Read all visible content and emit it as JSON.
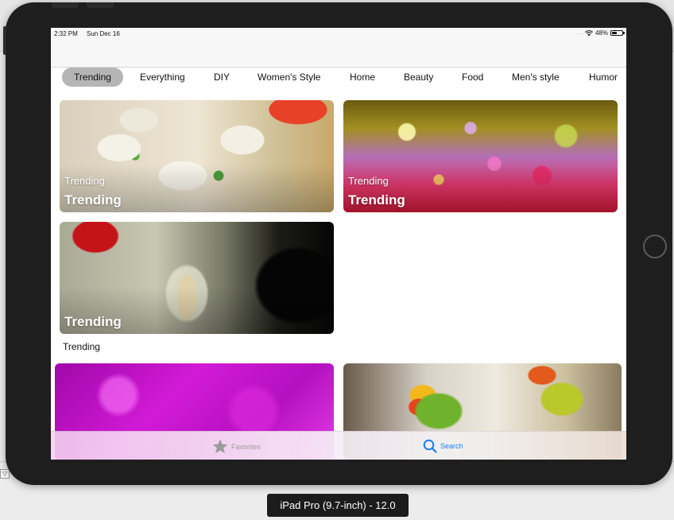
{
  "status_bar": {
    "time": "2:32 PM",
    "date": "Sun Dec 16",
    "signal_dots": "....",
    "battery": "48%"
  },
  "categories": [
    {
      "label": "Trending",
      "selected": true
    },
    {
      "label": "Everything",
      "selected": false
    },
    {
      "label": "DIY",
      "selected": false
    },
    {
      "label": "Women's Style",
      "selected": false
    },
    {
      "label": "Home",
      "selected": false
    },
    {
      "label": "Beauty",
      "selected": false
    },
    {
      "label": "Food",
      "selected": false
    },
    {
      "label": "Men's style",
      "selected": false
    },
    {
      "label": "Humor",
      "selected": false
    }
  ],
  "cards": [
    {
      "image": "spring-rolls-photo",
      "subtitle": "Trending",
      "title": "Trending"
    },
    {
      "image": "oil-bubbles-photo",
      "subtitle": "Trending",
      "title": "Trending"
    },
    {
      "image": "pouring-jar-photo",
      "title": "Trending",
      "caption": "Trending"
    },
    {
      "image": "purple-texture-photo"
    },
    {
      "image": "lovebirds-photo"
    }
  ],
  "tab_bar": {
    "favorites_label": "Favorites",
    "search_label": "Search"
  },
  "device_label": "iPad Pro (9.7-inch) - 12.0",
  "colors": {
    "accent": "#1a7ff0",
    "selected_pill": "#b5b5b5",
    "inactive_tab": "#9a9a9a",
    "device_bezel": "#1e1e1e"
  }
}
